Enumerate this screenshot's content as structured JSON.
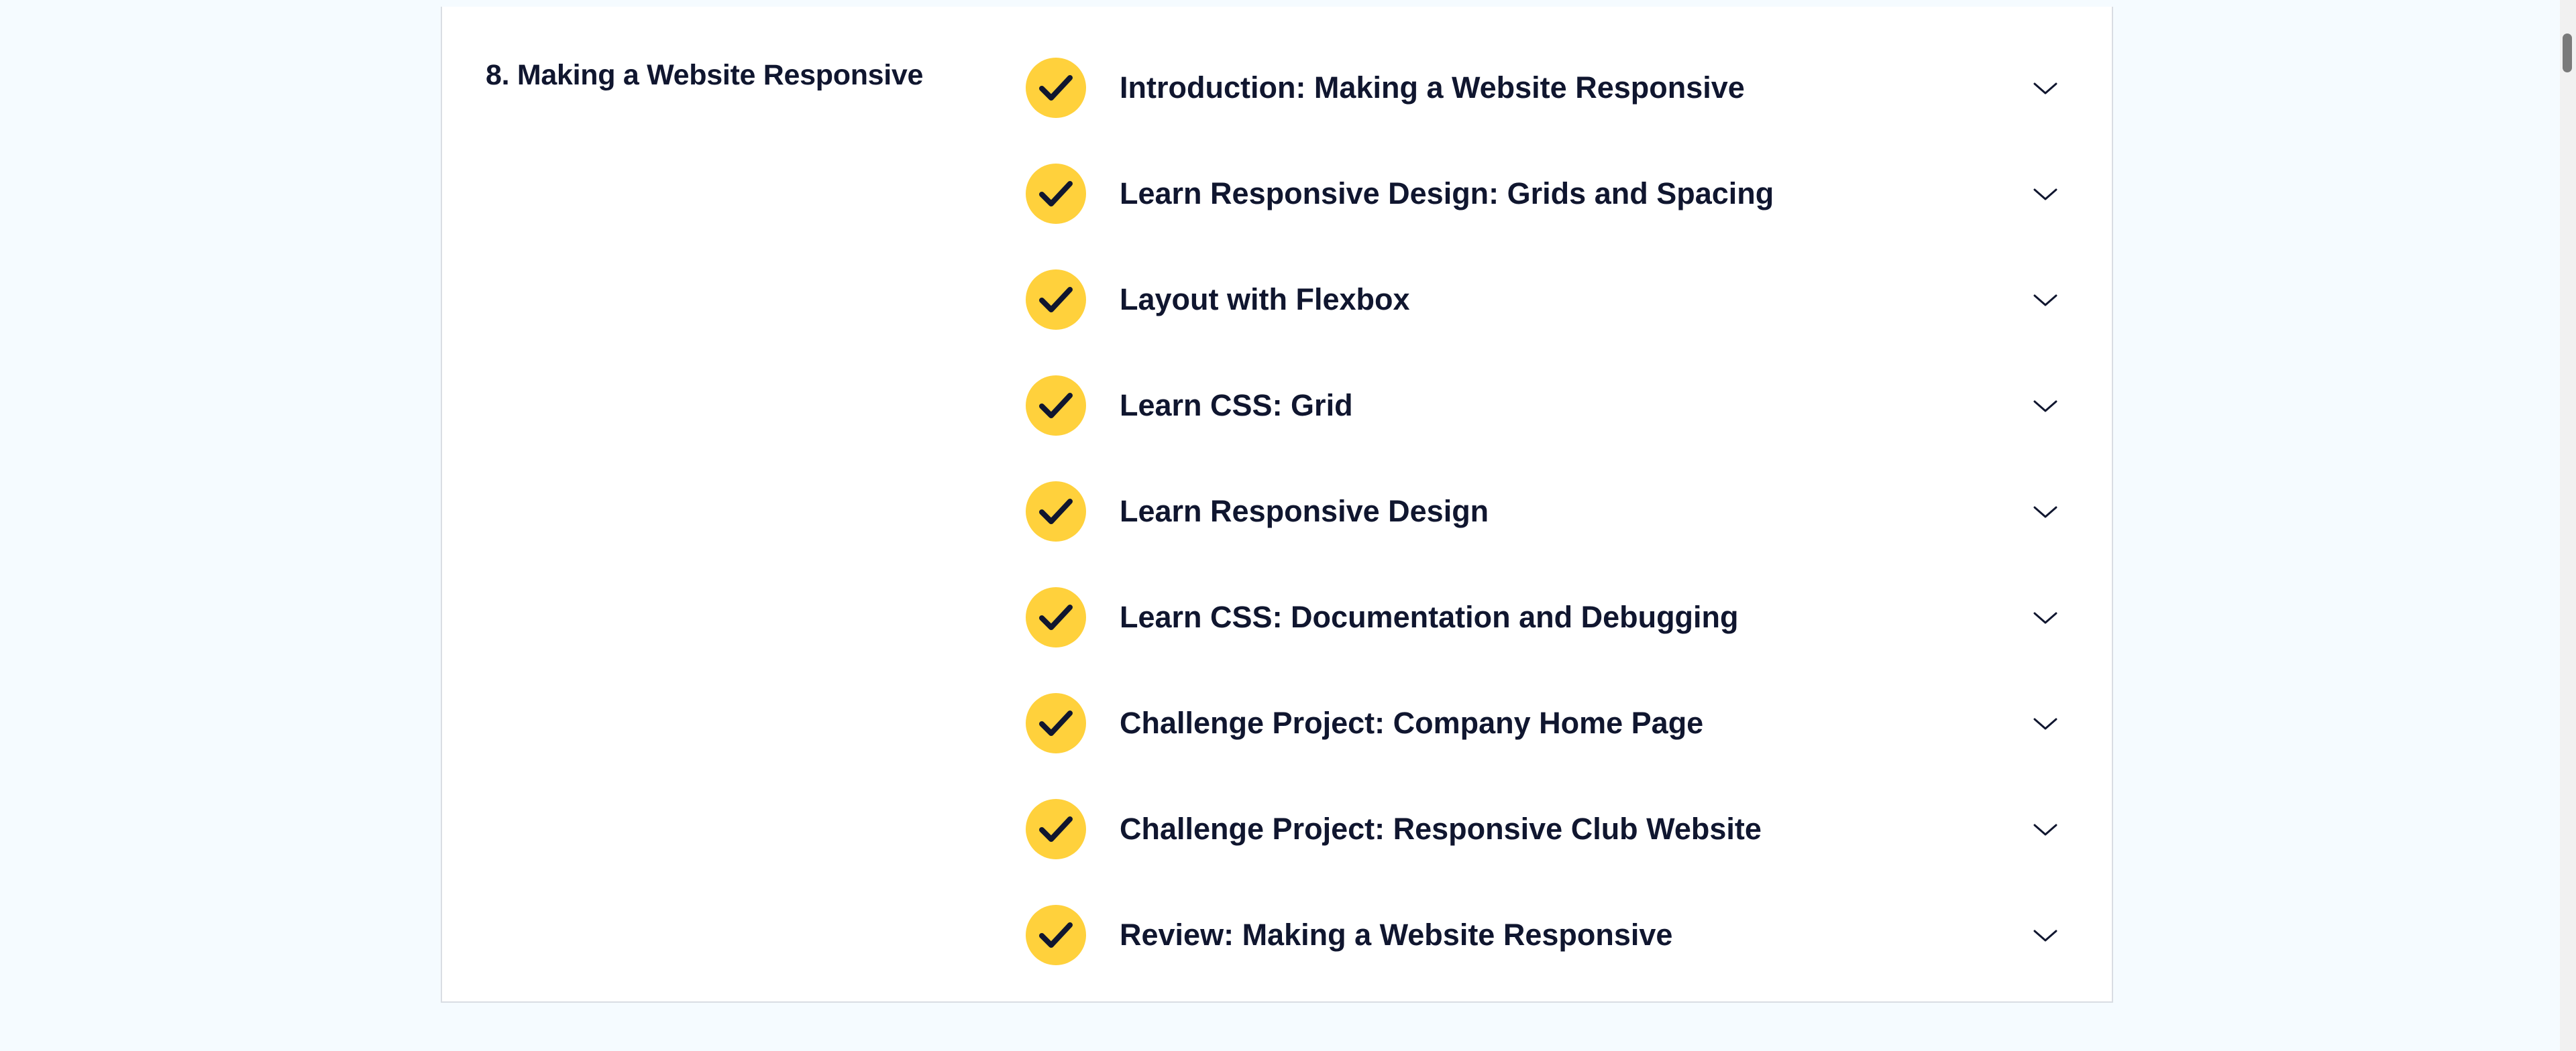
{
  "section": {
    "number": "8.",
    "title": "Making a Website Responsive",
    "full_title": "8. Making a Website Responsive"
  },
  "lessons": [
    {
      "title": "Introduction: Making a Website Responsive",
      "status": "completed",
      "icon": "check-icon"
    },
    {
      "title": "Learn Responsive Design: Grids and Spacing",
      "status": "completed",
      "icon": "check-icon"
    },
    {
      "title": "Layout with Flexbox",
      "status": "completed",
      "icon": "check-icon"
    },
    {
      "title": "Learn CSS: Grid",
      "status": "completed",
      "icon": "check-icon"
    },
    {
      "title": "Learn Responsive Design",
      "status": "completed",
      "icon": "check-icon"
    },
    {
      "title": "Learn CSS: Documentation and Debugging",
      "status": "completed",
      "icon": "check-icon"
    },
    {
      "title": "Challenge Project: Company Home Page",
      "status": "completed",
      "icon": "check-icon"
    },
    {
      "title": "Challenge Project: Responsive Club Website",
      "status": "completed",
      "icon": "check-icon"
    },
    {
      "title": "Review: Making a Website Responsive",
      "status": "completed",
      "icon": "check-icon"
    }
  ],
  "expand_icon": "chevron-down-icon",
  "colors": {
    "background": "#f5fbff",
    "card": "#ffffff",
    "check_fill": "#ffd13c",
    "text": "#10162f"
  }
}
